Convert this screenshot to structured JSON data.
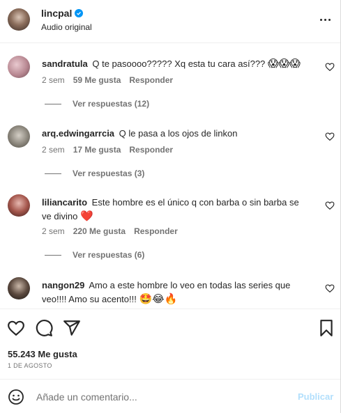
{
  "header": {
    "username": "lincpal",
    "subtitle": "Audio original"
  },
  "comments": [
    {
      "username": "sandratula",
      "text": "Q te pasoooo????? Xq esta tu cara así???",
      "emojis": "😱😱😱",
      "time": "2 sem",
      "likes": "59 Me gusta",
      "reply": "Responder",
      "view_replies": "Ver respuestas (12)"
    },
    {
      "username": "arq.edwingarrcia",
      "text": "Q le pasa a los ojos de linkon",
      "emojis": "",
      "time": "2 sem",
      "likes": "17 Me gusta",
      "reply": "Responder",
      "view_replies": "Ver respuestas (3)"
    },
    {
      "username": "liliancarito",
      "text": "Este hombre es el único q con barba o sin barba se ve divino",
      "emojis": "❤️",
      "time": "2 sem",
      "likes": "220 Me gusta",
      "reply": "Responder",
      "view_replies": "Ver respuestas (6)"
    },
    {
      "username": "nangon29",
      "text": "Amo a este hombre lo veo en todas las series que veo!!!! Amo su acento!!!",
      "emojis": "🤩😂🔥",
      "time": "",
      "likes": "",
      "reply": "",
      "view_replies": ""
    }
  ],
  "post": {
    "likes": "55.243 Me gusta",
    "date": "1 DE AGOSTO"
  },
  "composer": {
    "placeholder": "Añade un comentario...",
    "publish": "Publicar"
  },
  "colors": {
    "text": "#262626",
    "secondary": "#737373",
    "verified": "#0095f6",
    "publish_disabled": "#b2dffc",
    "heart_red": "#e0245e"
  }
}
